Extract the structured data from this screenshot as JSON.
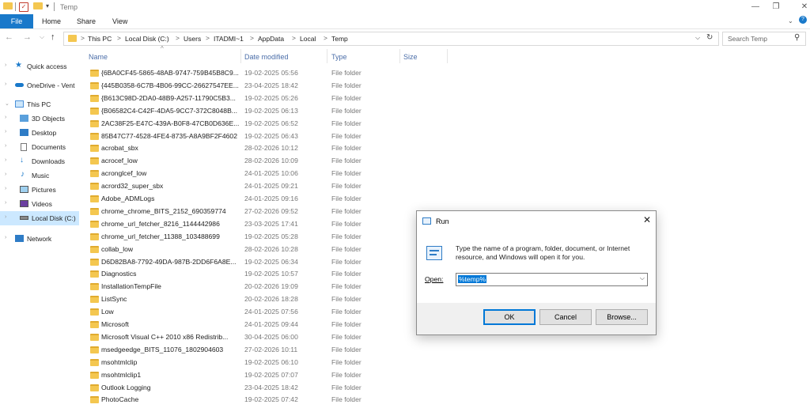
{
  "window": {
    "title": "Temp",
    "controls": {
      "minimize": "—",
      "maximize": "❐",
      "close": "✕"
    }
  },
  "ribbon": {
    "tabs": [
      "File",
      "Home",
      "Share",
      "View"
    ]
  },
  "address": {
    "back": "←",
    "forward": "→",
    "recent": "⌵",
    "up": "↑",
    "crumbs": [
      "This PC",
      "Local Disk (C:)",
      "Users",
      "ITADMI~1",
      "AppData",
      "Local",
      "Temp"
    ],
    "separator": ">",
    "dropdown": "⌵",
    "refresh": "↻",
    "search_placeholder": "Search Temp",
    "search_icon": "⚲"
  },
  "nav": {
    "items": [
      {
        "label": "Quick access",
        "icon": "star-icon"
      },
      {
        "label": "OneDrive - Vent",
        "icon": "cloud-icon"
      },
      {
        "label": "This PC",
        "icon": "computer-icon"
      },
      {
        "label": "3D Objects",
        "icon": "cube-icon"
      },
      {
        "label": "Desktop",
        "icon": "desktop-icon"
      },
      {
        "label": "Documents",
        "icon": "document-icon"
      },
      {
        "label": "Downloads",
        "icon": "download-icon"
      },
      {
        "label": "Music",
        "icon": "music-icon"
      },
      {
        "label": "Pictures",
        "icon": "picture-icon"
      },
      {
        "label": "Videos",
        "icon": "video-icon"
      },
      {
        "label": "Local Disk (C:)",
        "icon": "drive-icon",
        "selected": true
      },
      {
        "label": "Network",
        "icon": "network-icon"
      }
    ]
  },
  "columns": {
    "name": "Name",
    "date": "Date modified",
    "type": "Type",
    "size": "Size",
    "sort_indicator": "^"
  },
  "files": [
    {
      "name": "{6BA0CF45-5865-48AB-9747-759B45B8C9...",
      "date": "19-02-2025 05:56",
      "type": "File folder"
    },
    {
      "name": "{445B0358-6C7B-4B06-99CC-26627547EE...",
      "date": "23-04-2025 18:42",
      "type": "File folder"
    },
    {
      "name": "{B613C98D-2DA0-48B9-A257-11790C5B3...",
      "date": "19-02-2025 05:26",
      "type": "File folder"
    },
    {
      "name": "{B06582C4-C42F-4DA5-9CC7-372C8048B...",
      "date": "19-02-2025 06:13",
      "type": "File folder"
    },
    {
      "name": "2AC38F25-E47C-439A-B0F8-47CB0D636E...",
      "date": "19-02-2025 06:52",
      "type": "File folder"
    },
    {
      "name": "85B47C77-4528-4FE4-8735-A8A9BF2F4602",
      "date": "19-02-2025 06:43",
      "type": "File folder"
    },
    {
      "name": "acrobat_sbx",
      "date": "28-02-2026 10:12",
      "type": "File folder"
    },
    {
      "name": "acrocef_low",
      "date": "28-02-2026 10:09",
      "type": "File folder"
    },
    {
      "name": "acronglcef_low",
      "date": "24-01-2025 10:06",
      "type": "File folder"
    },
    {
      "name": "acrord32_super_sbx",
      "date": "24-01-2025 09:21",
      "type": "File folder"
    },
    {
      "name": "Adobe_ADMLogs",
      "date": "24-01-2025 09:16",
      "type": "File folder"
    },
    {
      "name": "chrome_chrome_BITS_2152_690359774",
      "date": "27-02-2026 09:52",
      "type": "File folder"
    },
    {
      "name": "chrome_url_fetcher_8216_1144442986",
      "date": "23-03-2025 17:41",
      "type": "File folder"
    },
    {
      "name": "chrome_url_fetcher_11388_103488699",
      "date": "19-02-2025 05:28",
      "type": "File folder"
    },
    {
      "name": "collab_low",
      "date": "28-02-2026 10:28",
      "type": "File folder"
    },
    {
      "name": "D6D82BA8-7792-49DA-987B-2DD6F6A8E...",
      "date": "19-02-2025 06:34",
      "type": "File folder"
    },
    {
      "name": "Diagnostics",
      "date": "19-02-2025 10:57",
      "type": "File folder"
    },
    {
      "name": "InstallationTempFile",
      "date": "20-02-2026 19:09",
      "type": "File folder"
    },
    {
      "name": "ListSync",
      "date": "20-02-2026 18:28",
      "type": "File folder"
    },
    {
      "name": "Low",
      "date": "24-01-2025 07:56",
      "type": "File folder"
    },
    {
      "name": "Microsoft",
      "date": "24-01-2025 09:44",
      "type": "File folder"
    },
    {
      "name": "Microsoft Visual C++ 2010  x86 Redistrib...",
      "date": "30-04-2025 06:00",
      "type": "File folder"
    },
    {
      "name": "msedgeedge_BITS_11076_1802904603",
      "date": "27-02-2026 10:11",
      "type": "File folder"
    },
    {
      "name": "msohtmlclip",
      "date": "19-02-2025 06:10",
      "type": "File folder"
    },
    {
      "name": "msohtmlclip1",
      "date": "19-02-2025 07:07",
      "type": "File folder"
    },
    {
      "name": "Outlook Logging",
      "date": "23-04-2025 18:42",
      "type": "File folder"
    },
    {
      "name": "PhotoCache",
      "date": "19-02-2025 07:42",
      "type": "File folder"
    }
  ],
  "run_dialog": {
    "title": "Run",
    "close": "✕",
    "description": "Type the name of a program, folder, document, or Internet resource, and Windows will open it for you.",
    "open_label": "Open:",
    "open_value": "%temp%",
    "dropdown": "⌵",
    "ok": "OK",
    "cancel": "Cancel",
    "browse": "Browse..."
  },
  "colors": {
    "accent": "#1979ca",
    "folder": "#f4c750",
    "selection": "#cce8ff",
    "header_text": "#4b6ea9"
  }
}
